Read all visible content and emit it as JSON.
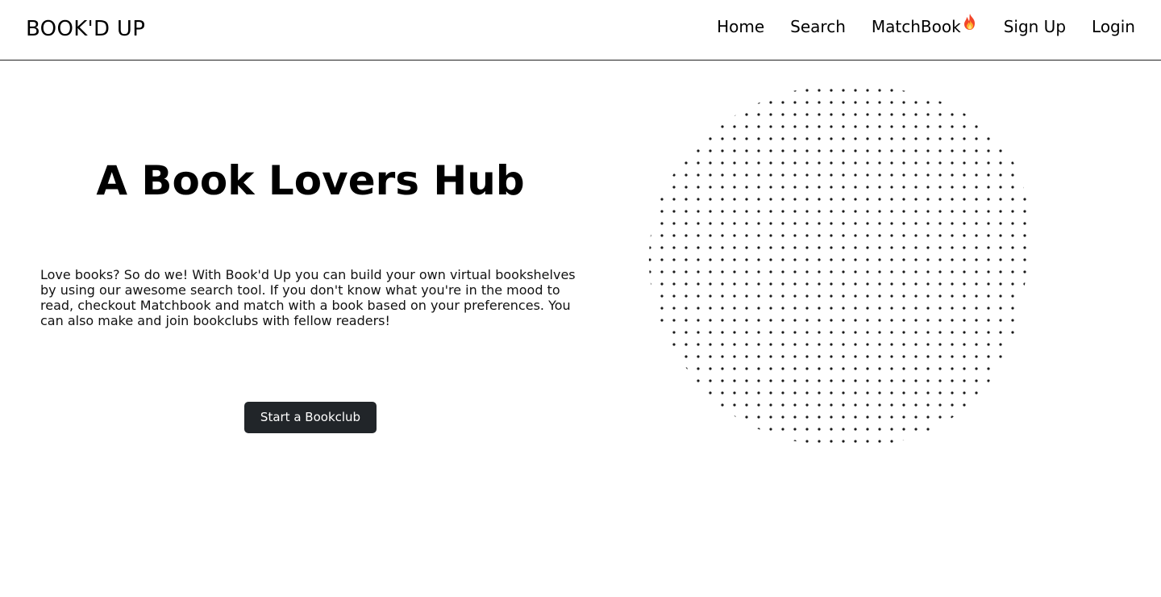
{
  "navbar": {
    "brand": "BOOK'D UP",
    "links": [
      {
        "label": "Home"
      },
      {
        "label": "Search"
      },
      {
        "label": "MatchBook",
        "icon": "fire-icon"
      },
      {
        "label": "Sign Up"
      },
      {
        "label": "Login"
      }
    ]
  },
  "hero": {
    "title": "A Book Lovers Hub",
    "description": "Love books? So do we! With Book'd Up you can build your own virtual bookshelves by using our awesome search tool. If you don't know what you're in the mood to read, checkout Matchbook and match with a book based on your preferences. You can also make and join bookclubs with fellow readers!",
    "cta_label": "Start a Bookclub",
    "illustration_icon": "dot-pattern-blob"
  },
  "colors": {
    "background": "#ffffff",
    "text": "#000000",
    "button_bg": "#212529",
    "button_text": "#ffffff"
  }
}
